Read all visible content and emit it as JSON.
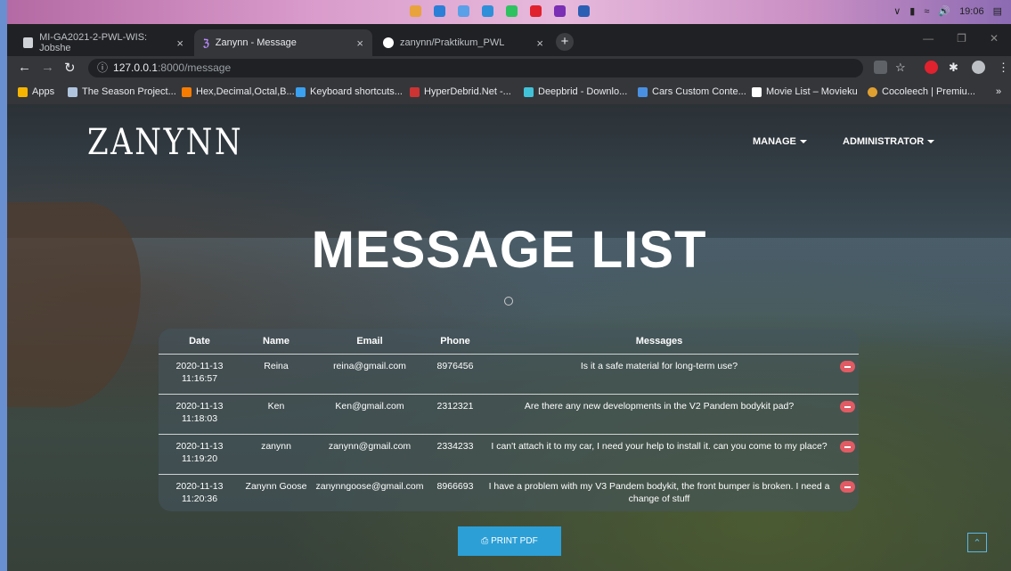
{
  "taskbar": {
    "time": "19:06"
  },
  "tabs": [
    {
      "label": "MI-GA2021-2-PWL-WIS: Jobshe",
      "icon": "moodle-icon",
      "color": "#cfd3d8"
    },
    {
      "label": "Zanynn - Message",
      "icon": "z-logo-icon",
      "color": "#b98cff"
    },
    {
      "label": "zanynn/Praktikum_PWL",
      "icon": "github-icon",
      "color": "#ffffff"
    }
  ],
  "address": {
    "host": "127.0.0.1",
    "path": ":8000/message"
  },
  "bookmarks": [
    {
      "label": "Apps",
      "icon": "apps-grid-icon",
      "color": "#f5b400"
    },
    {
      "label": "The Season Project...",
      "icon": "ll-icon",
      "color": "#b0c4de"
    },
    {
      "label": "Hex,Decimal,Octal,B...",
      "icon": "r-icon",
      "color": "#f57c00"
    },
    {
      "label": "Keyboard shortcuts...",
      "icon": "windows-icon",
      "color": "#3aa0f0"
    },
    {
      "label": "HyperDebrid.Net -...",
      "icon": "hyperdebrid-icon",
      "color": "#cc3333"
    },
    {
      "label": "Deepbrid - Downlo...",
      "icon": "deepbrid-icon",
      "color": "#41c2d8"
    },
    {
      "label": "Cars Custom Conte...",
      "icon": "sj-icon",
      "color": "#4a90e2"
    },
    {
      "label": "Movie List – Movieku",
      "icon": "m-icon",
      "color": "#ffffff"
    },
    {
      "label": "Cocoleech | Premiu...",
      "icon": "cocoleech-icon",
      "color": "#e0a030"
    }
  ],
  "site": {
    "logo": "ZANYNN",
    "menu": [
      "MANAGE",
      "ADMINISTRATOR"
    ],
    "title": "MESSAGE LIST",
    "table": {
      "headers": [
        "Date",
        "Name",
        "Email",
        "Phone",
        "Messages"
      ],
      "rows": [
        {
          "date": "2020-11-13 11:16:57",
          "name": "Reina",
          "email": "reina@gmail.com",
          "phone": "8976456",
          "message": "Is it a safe material for long-term use?"
        },
        {
          "date": "2020-11-13 11:18:03",
          "name": "Ken",
          "email": "Ken@gmail.com",
          "phone": "2312321",
          "message": "Are there any new developments in the V2 Pandem bodykit pad?"
        },
        {
          "date": "2020-11-13 11:19:20",
          "name": "zanynn",
          "email": "zanynn@gmail.com",
          "phone": "2334233",
          "message": "I can't attach it to my car, I need your help to install it. can you come to my place?"
        },
        {
          "date": "2020-11-13 11:20:36",
          "name": "Zanynn Goose",
          "email": "zanynngoose@gmail.com",
          "phone": "8966693",
          "message": "I have a problem with my V3 Pandem bodykit, the front bumper is broken. I need a change of stuff"
        }
      ]
    },
    "print_label": "PRINT PDF",
    "accent": "#2c9fd6",
    "delete_color": "#e05b63"
  }
}
